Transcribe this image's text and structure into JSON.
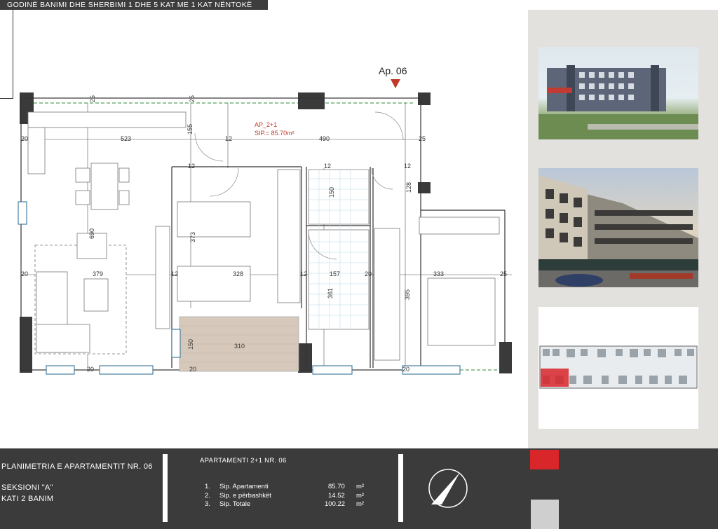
{
  "header": {
    "title": "GODINË BANIMI DHE SHERBIMI 1 DHE 5 KAT ME 1 KAT NËNTOKË"
  },
  "plan": {
    "apartment_marker": "Ap. 06",
    "room_label": "AP_2+1",
    "area_label": "SIP.= 85.70m²",
    "dims": [
      "523",
      "490",
      "155",
      "12",
      "25",
      "20",
      "25",
      "25",
      "12",
      "12",
      "150",
      "128",
      "12",
      "20",
      "690",
      "373",
      "379",
      "12",
      "328",
      "12",
      "157",
      "20",
      "333",
      "25",
      "20",
      "361",
      "395",
      "150",
      "310",
      "20",
      "20"
    ]
  },
  "images": {
    "photo1": "building-photo",
    "photo2": "building-render",
    "photo3": "floor-plan-overview"
  },
  "footer": {
    "plan_title": "PLANIMETRIA E APARTAMENTIT NR. 06",
    "section": "SEKSIONI \"A\"",
    "floor": "KATI 2 BANIM",
    "table_title": "APARTAMENTI 2+1 NR. 06",
    "rows": [
      {
        "num": "1.",
        "label": "Sip. Apartamenti",
        "value": "85.70",
        "unit": "m²"
      },
      {
        "num": "2.",
        "label": "Sip. e përbashkët",
        "value": "14.52",
        "unit": "m²"
      },
      {
        "num": "3.",
        "label": "Sip. Totale",
        "value": "100.22",
        "unit": "m²"
      }
    ]
  },
  "colors": {
    "accent_red": "#d8262a",
    "bar": "#3b3b3b",
    "sidebar": "#e3e1de",
    "wall": "#3a3a3a",
    "floor_wood": "#d6c8bb"
  }
}
